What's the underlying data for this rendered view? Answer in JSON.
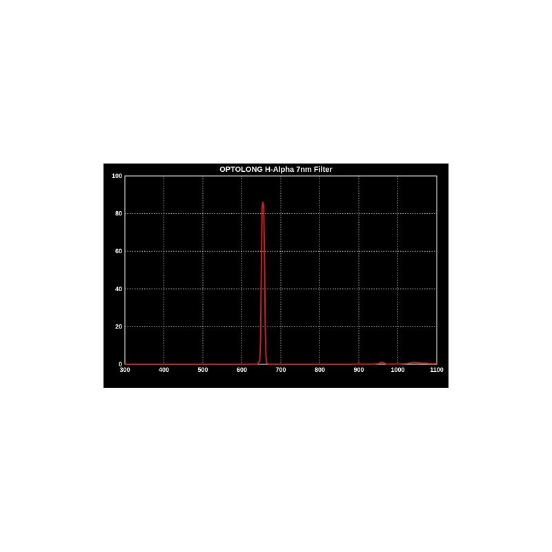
{
  "chart_data": {
    "type": "line",
    "title": "OPTOLONG H-Alpha 7nm Filter",
    "xlabel": "",
    "ylabel": "",
    "xlim": [
      300,
      1100
    ],
    "ylim": [
      0,
      100
    ],
    "x_ticks": [
      300,
      400,
      500,
      600,
      700,
      800,
      900,
      1000,
      1100
    ],
    "y_ticks": [
      0,
      20,
      40,
      60,
      80,
      100
    ],
    "grid": true,
    "legend": "none",
    "colors": {
      "background": "#000000",
      "axes": "#ffffff",
      "grid": "#d0d0d0",
      "series": "#cc1f1f"
    },
    "series": [
      {
        "x": [
          300,
          400,
          500,
          600,
          640,
          646,
          648,
          650,
          652,
          654,
          656,
          658,
          660,
          662,
          664,
          670,
          700,
          800,
          880,
          900,
          910,
          930,
          950,
          955,
          960,
          965,
          970,
          990,
          1020,
          1030,
          1040,
          1050,
          1060,
          1070,
          1080,
          1090,
          1100
        ],
        "y": [
          0,
          0,
          0,
          0,
          0.1,
          2,
          12,
          50,
          83,
          86,
          84,
          60,
          20,
          4,
          0.5,
          0,
          0,
          0,
          0,
          0.2,
          0.1,
          0.1,
          0.3,
          0.7,
          1.0,
          0.6,
          0.2,
          0.1,
          0.3,
          0.6,
          0.9,
          0.8,
          0.6,
          0.6,
          0.4,
          0.3,
          0.5
        ]
      }
    ]
  }
}
